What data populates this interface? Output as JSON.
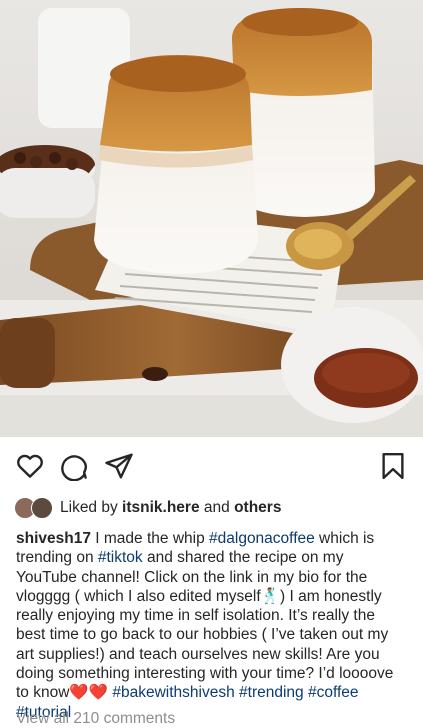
{
  "likes": {
    "prefix": "Liked by ",
    "user": "itsnik.here",
    "middle": " and ",
    "others": "others"
  },
  "caption": {
    "username": "shivesh17",
    "text1": " I made the whip ",
    "tag1": "#dalgonacoffee",
    "text2": " which is trending on ",
    "tag2": "#tiktok",
    "text3": " and shared the recipe on my YouTube channel! Click on the link in my bio for the vlogggg ( which I also edited myself",
    "emoji1": "🕺🏽",
    "text4": ") I am honestly really enjoying my time in self isolation. It’s really the best time to go back to our hobbies ( I’ve taken out my art supplies!) and teach ourselves new skills! Are you doing something interesting with your time? I’d loooove to know",
    "hearts": "❤️❤️",
    "tag3": "#bakewithshivesh",
    "tag4": "#trending",
    "tag5": "#coffee",
    "tag6": "#tutorial"
  },
  "comments": {
    "view_all": "View all 210 comments"
  },
  "icons": {
    "like": "heart-outline-icon",
    "comment": "speech-bubble-icon",
    "share": "paper-plane-icon",
    "save": "bookmark-icon"
  },
  "colors": {
    "hashtag": "#0c3b6f",
    "muted": "#8e8e8e",
    "text": "#262626"
  }
}
